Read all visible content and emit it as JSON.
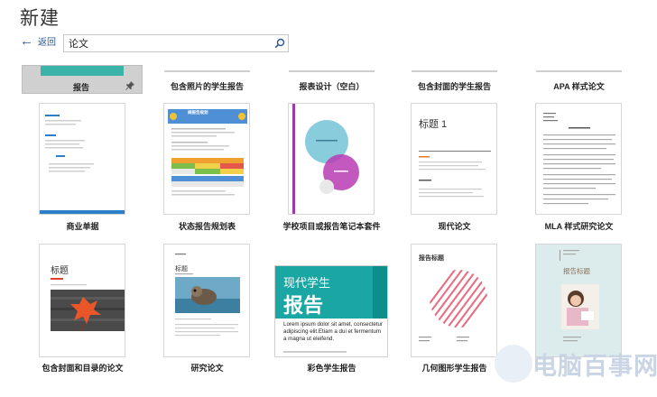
{
  "header": {
    "title": "新建",
    "back_label": "返回"
  },
  "search": {
    "value": "论文",
    "icon": "search-icon"
  },
  "row1": [
    {
      "label": "报告",
      "selected": true,
      "pinned": true
    },
    {
      "label": "包含照片的学生报告"
    },
    {
      "label": "报表设计（空白）"
    },
    {
      "label": "包含封面的学生报告"
    },
    {
      "label": "APA 样式论文"
    }
  ],
  "row2": [
    {
      "label": "商业单据"
    },
    {
      "label": "状态报告规划表",
      "banner": "阀报告规划"
    },
    {
      "label": "学校项目或报告笔记本套件"
    },
    {
      "label": "现代论文",
      "heading": "标题 1"
    },
    {
      "label": "MLA 样式研究论文"
    }
  ],
  "row3": [
    {
      "label": "包含封面和目录的论文",
      "heading": "标题"
    },
    {
      "label": "研究论文",
      "heading": "标题"
    },
    {
      "label": "彩色学生报告",
      "line1": "现代学生",
      "line2": "报告",
      "body": "Lorem ipsum dolor sit amet, consectetur adipiscing elit.Etiam a dui et fermentum a magna ut eleifend."
    },
    {
      "label": "几何图形学生报告",
      "heading": "报告标题"
    },
    {
      "label": "",
      "heading": "报告标题"
    }
  ],
  "watermark": {
    "text": "电脑百事网"
  },
  "colors": {
    "accent": "#2b5797",
    "teal": "#3bb3a8",
    "magenta": "#b93aa8",
    "selected_bg": "#d0d0d0"
  }
}
